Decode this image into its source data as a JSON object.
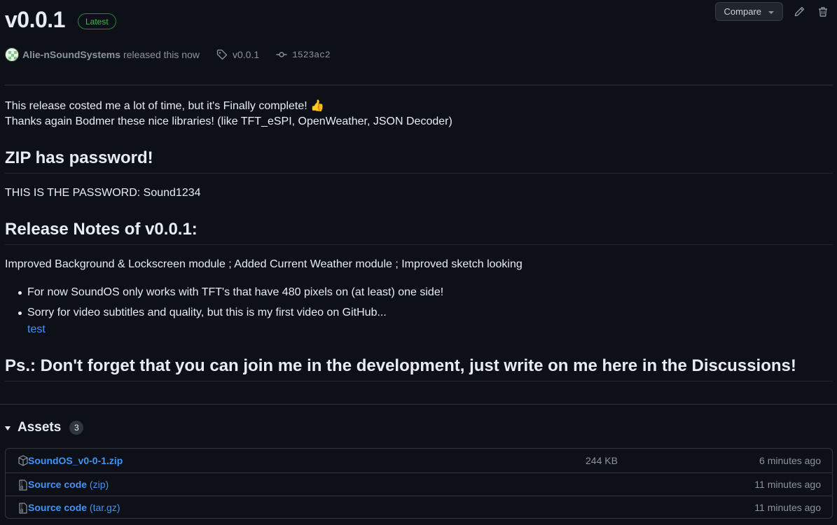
{
  "release": {
    "title": "v0.0.1",
    "badge": "Latest",
    "author": "Alie-nSoundSystems",
    "released_text": "released this now",
    "tag": "v0.0.1",
    "commit": "1523ac2"
  },
  "toolbar": {
    "compare_label": "Compare"
  },
  "notes": {
    "intro_line1": "This release costed me a lot of time, but it's Finally complete! 👍",
    "intro_line2": "Thanks again Bodmer these nice libraries! (like TFT_eSPI, OpenWeather, JSON Decoder)",
    "h_zip": "ZIP has password!",
    "password_line": "THIS IS THE PASSWORD: Sound1234",
    "h_release_notes": "Release Notes of v0.0.1:",
    "summary": "Improved Background & Lockscreen module ; Added Current Weather module ; Improved sketch looking",
    "bullets": [
      "For now SoundOS only works with TFT's that have 480 pixels on (at least) one side!",
      "Sorry for video subtitles and quality, but this is my first video on GitHub..."
    ],
    "link_text": "test",
    "h_ps": "Ps.: Don't forget that you can join me in the development, just write on me here in the Discussions!"
  },
  "assets": {
    "title": "Assets",
    "count": "3",
    "items": [
      {
        "name": "SoundOS_v0-0-1.zip",
        "suffix": "",
        "size": "244 KB",
        "time": "6 minutes ago",
        "icon": "package-icon"
      },
      {
        "name": "Source code",
        "suffix": "(zip)",
        "size": "",
        "time": "11 minutes ago",
        "icon": "file-zip-icon"
      },
      {
        "name": "Source code",
        "suffix": "(tar.gz)",
        "size": "",
        "time": "11 minutes ago",
        "icon": "file-zip-icon"
      }
    ]
  },
  "colors": {
    "background": "#0d1117",
    "text": "#e6edf3",
    "muted": "#8b949e",
    "link": "#4493f8",
    "latest_badge": "#3fb950",
    "border": "#30363d"
  }
}
